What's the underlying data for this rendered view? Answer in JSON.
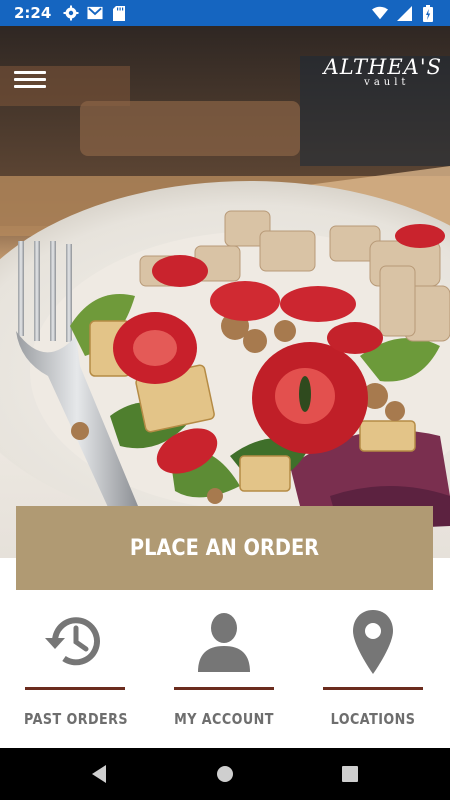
{
  "status_bar": {
    "time": "2:24",
    "left_icons": [
      "gear-icon",
      "mail-icon",
      "sd-card-icon"
    ],
    "right_icons": [
      "wifi-icon",
      "signal-icon",
      "battery-icon"
    ]
  },
  "header": {
    "logo_main": "ALTHEA'S",
    "logo_sub": "vault"
  },
  "hero": {
    "image": "salad-with-strawberries-and-fork"
  },
  "order_button": {
    "label": "PLACE AN ORDER"
  },
  "nav": [
    {
      "label": "PAST ORDERS",
      "icon": "history-icon"
    },
    {
      "label": "MY ACCOUNT",
      "icon": "user-icon"
    },
    {
      "label": "LOCATIONS",
      "icon": "map-pin-icon"
    }
  ],
  "colors": {
    "status_bar": "#1565c0",
    "button": "#b09a73",
    "rule": "#6b2c1e",
    "label": "#6e6e6e",
    "icon": "#767676"
  }
}
